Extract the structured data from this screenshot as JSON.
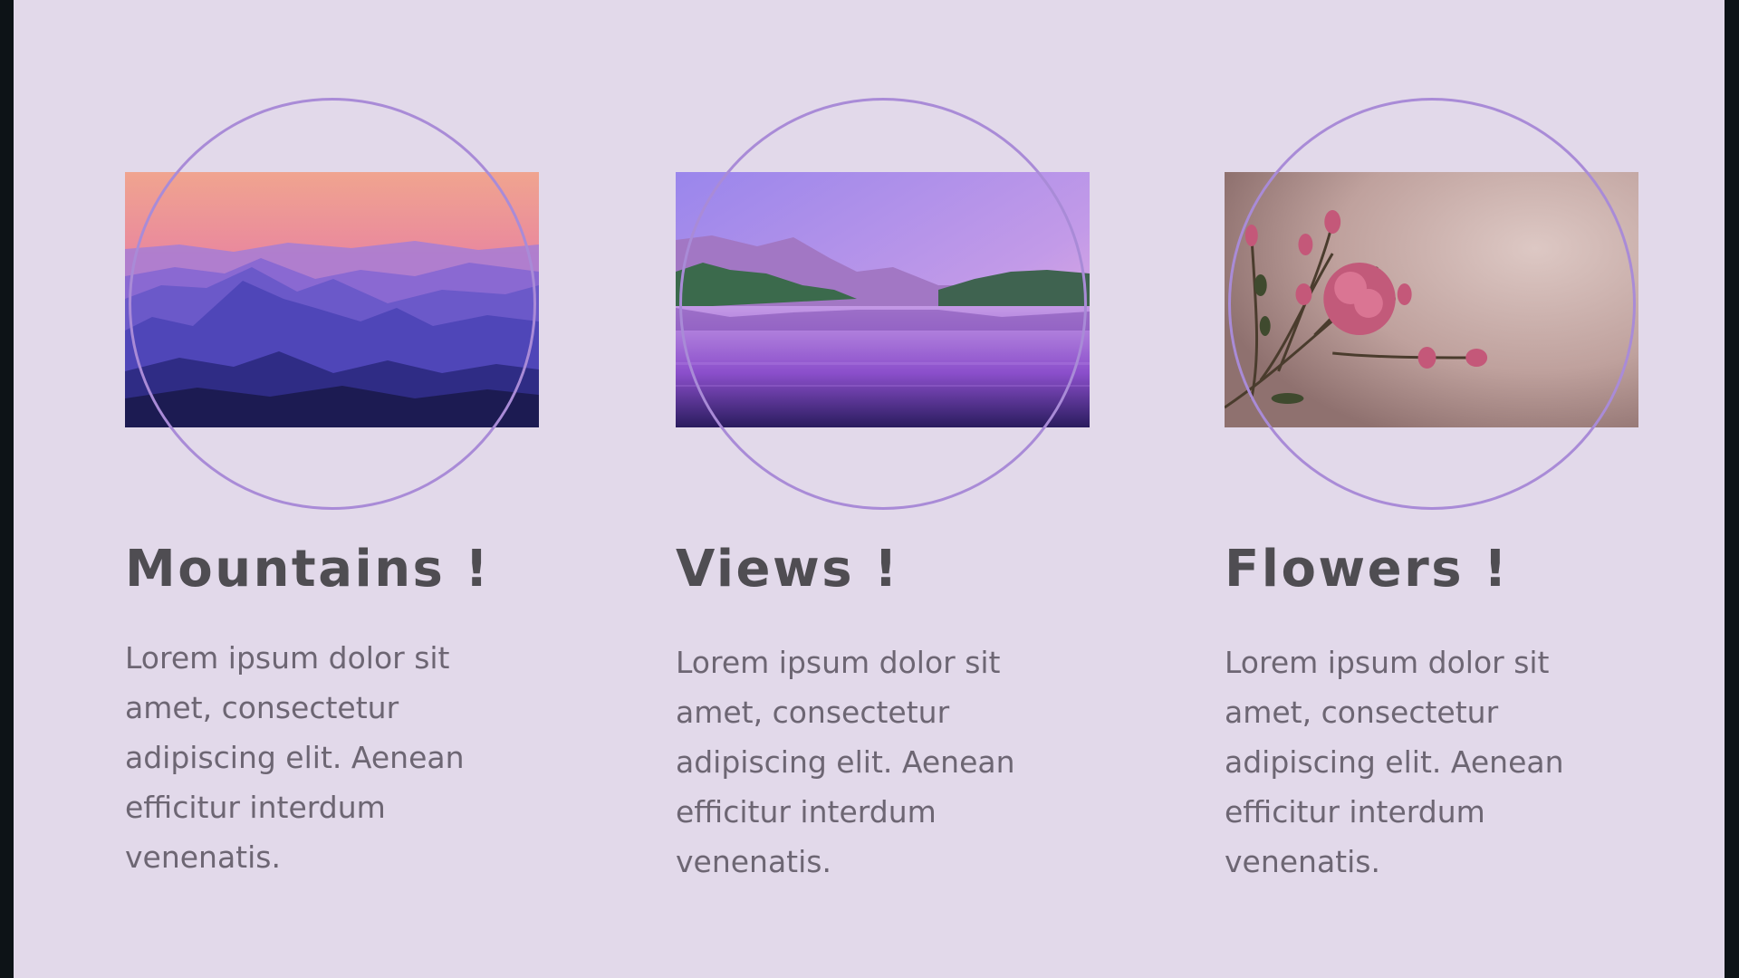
{
  "cards": [
    {
      "title": "Mountains !",
      "text": "Lorem ipsum dolor sit amet, consectetur adipiscing elit. Aenean efficitur interdum venenatis.",
      "image": "mountains-photo"
    },
    {
      "title": "Views !",
      "text": "Lorem ipsum dolor sit amet, consectetur adipiscing elit. Aenean efficitur interdum venenatis.",
      "image": "lake-photo"
    },
    {
      "title": "Flowers !",
      "text": "Lorem ipsum dolor sit amet, consectetur adipiscing elit. Aenean efficitur interdum venenatis.",
      "image": "rose-photo"
    }
  ],
  "colors": {
    "background": "#e2d9ea",
    "ring": "#a98bd7",
    "title": "#4f4d52",
    "text": "#6d6673",
    "frame": "#0d1317"
  }
}
